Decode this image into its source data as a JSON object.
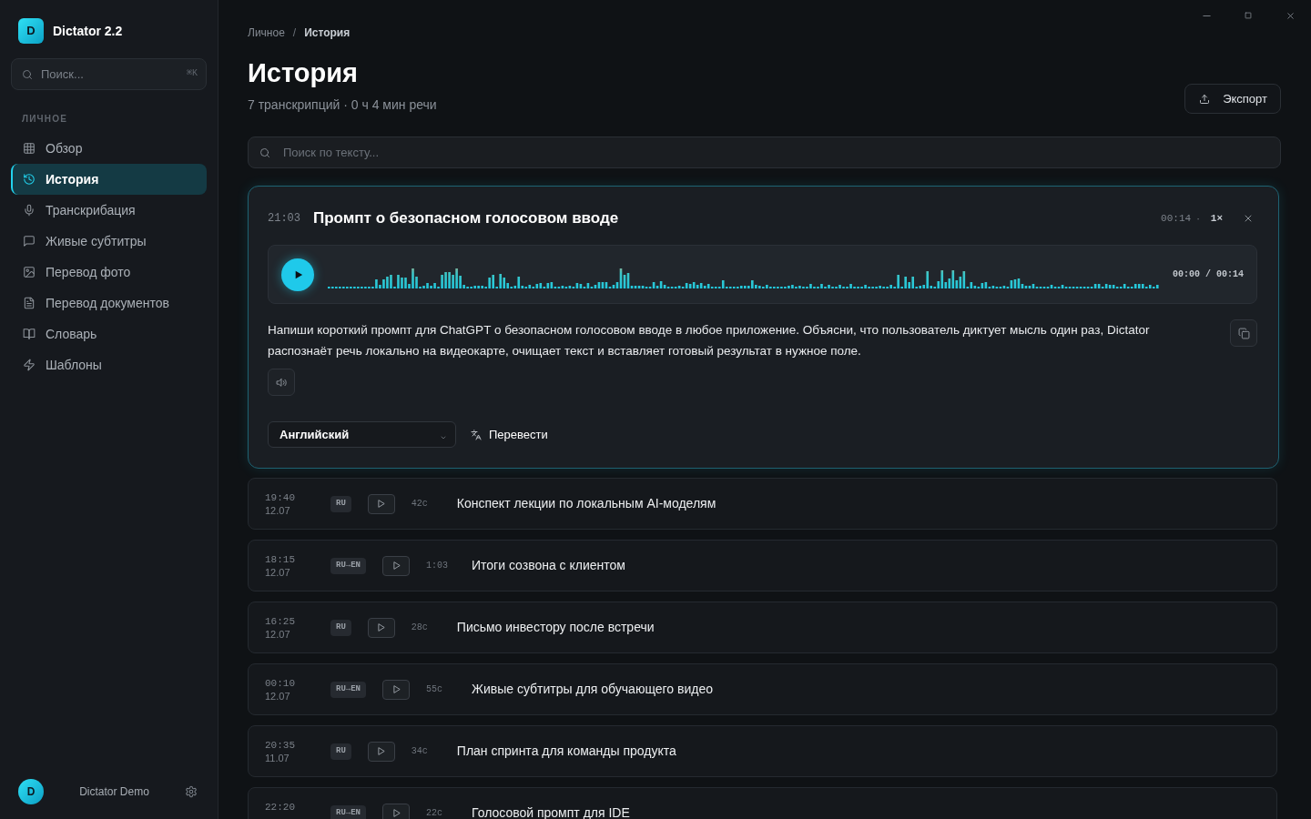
{
  "sidebar": {
    "app": {
      "logo_letter": "D",
      "name": "Dictator 2.2"
    },
    "search": {
      "placeholder": "Поиск...",
      "shortcut": "⌘K"
    },
    "section_label": "ЛИЧНОЕ",
    "items": [
      {
        "label": "Обзор",
        "selected": false
      },
      {
        "label": "История",
        "selected": true
      },
      {
        "label": "Транскрибация",
        "selected": false
      },
      {
        "label": "Живые субтитры",
        "selected": false
      },
      {
        "label": "Перевод фото",
        "selected": false
      },
      {
        "label": "Перевод документов",
        "selected": false
      },
      {
        "label": "Словарь",
        "selected": false
      },
      {
        "label": "Шаблоны",
        "selected": false
      }
    ],
    "user": {
      "avatar_letter": "D",
      "name": "Dictator Demo"
    }
  },
  "breadcrumb": {
    "items": [
      {
        "label": "Личное",
        "current": false
      },
      {
        "label": "История",
        "current": true
      }
    ],
    "separator": "/"
  },
  "header": {
    "title": "История",
    "subtitle": "7 транскрипций · 0 ч 4 мин речи",
    "export_button": "Экспорт"
  },
  "search": {
    "placeholder": "Поиск по тексту..."
  },
  "open_transcript": {
    "time": "21:03",
    "title": "Промпт о безопасном голосовом вводе",
    "duration": "00:14",
    "separator": "·",
    "speed": "1×",
    "player": {
      "time": "00:00 / 00:14"
    },
    "text": "Напиши короткий промпт для ChatGPT о безопасном голосовом вводе в любое приложение. Объясни, что пользователь диктует мысль один раз, Dictator распознаёт речь локально на видеокарте, очищает текст и вставляет готовый результат в нужное поле.",
    "language": "Английский",
    "translate_button": "Перевести"
  },
  "transcripts": [
    {
      "time": "19:40",
      "date": "12.07",
      "language": "RU",
      "duration": "42с",
      "title": "Конспект лекции по локальным AI-моделям"
    },
    {
      "time": "18:15",
      "date": "12.07",
      "language": "RU→EN",
      "duration": "1:03",
      "title": "Итоги созвона с клиентом"
    },
    {
      "time": "16:25",
      "date": "12.07",
      "language": "RU",
      "duration": "28с",
      "title": "Письмо инвестору после встречи"
    },
    {
      "time": "00:10",
      "date": "12.07",
      "language": "RU→EN",
      "duration": "55с",
      "title": "Живые субтитры для обучающего видео"
    },
    {
      "time": "20:35",
      "date": "11.07",
      "language": "RU",
      "duration": "34с",
      "title": "План спринта для команды продукта"
    },
    {
      "time": "22:20",
      "language": "RU→EN",
      "duration": "22с",
      "title": "Голосовой промпт для IDE"
    }
  ]
}
